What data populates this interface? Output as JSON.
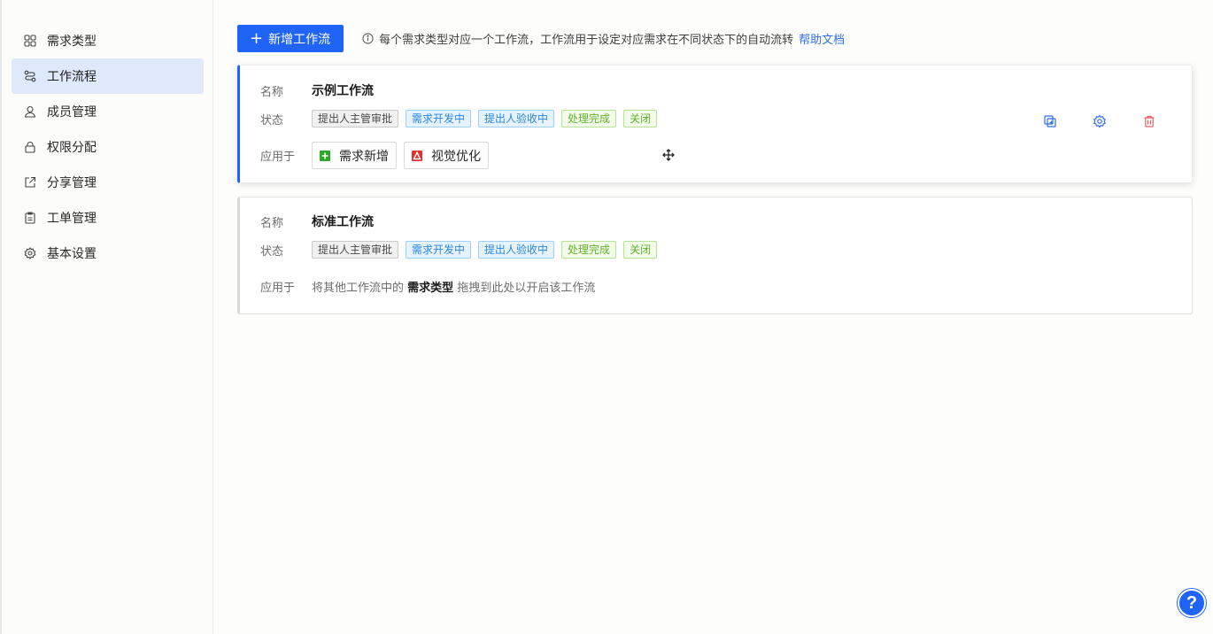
{
  "sidebar": {
    "items": [
      {
        "label": "需求类型",
        "icon": "grid-icon"
      },
      {
        "label": "工作流程",
        "icon": "workflow-icon",
        "active": true
      },
      {
        "label": "成员管理",
        "icon": "user-icon"
      },
      {
        "label": "权限分配",
        "icon": "lock-icon"
      },
      {
        "label": "分享管理",
        "icon": "share-icon"
      },
      {
        "label": "工单管理",
        "icon": "clipboard-icon"
      },
      {
        "label": "基本设置",
        "icon": "gear-icon"
      }
    ]
  },
  "toolbar": {
    "add_label": "新增工作流",
    "tip_text": "每个需求类型对应一个工作流，工作流用于设定对应需求在不同状态下的自动流转",
    "help_link": "帮助文档"
  },
  "workflows": [
    {
      "name_label": "名称",
      "name": "示例工作流",
      "status_label": "状态",
      "statuses": [
        "提出人主管审批",
        "需求开发中",
        "提出人验收中",
        "处理完成",
        "关闭"
      ],
      "apply_label": "应用于",
      "applied": [
        {
          "label": "需求新增",
          "color": "#2ea52a"
        },
        {
          "label": "视觉优化",
          "color": "#e0312d"
        }
      ]
    },
    {
      "name_label": "名称",
      "name": "标准工作流",
      "status_label": "状态",
      "statuses": [
        "提出人主管审批",
        "需求开发中",
        "提出人验收中",
        "处理完成",
        "关闭"
      ],
      "apply_label": "应用于",
      "hint_before": "将其他工作流中的",
      "hint_bold": "需求类型",
      "hint_after": "拖拽到此处以开启该工作流"
    }
  ],
  "help_button": "?",
  "colors": {
    "primary": "#1f64f5",
    "danger": "#e86060"
  }
}
